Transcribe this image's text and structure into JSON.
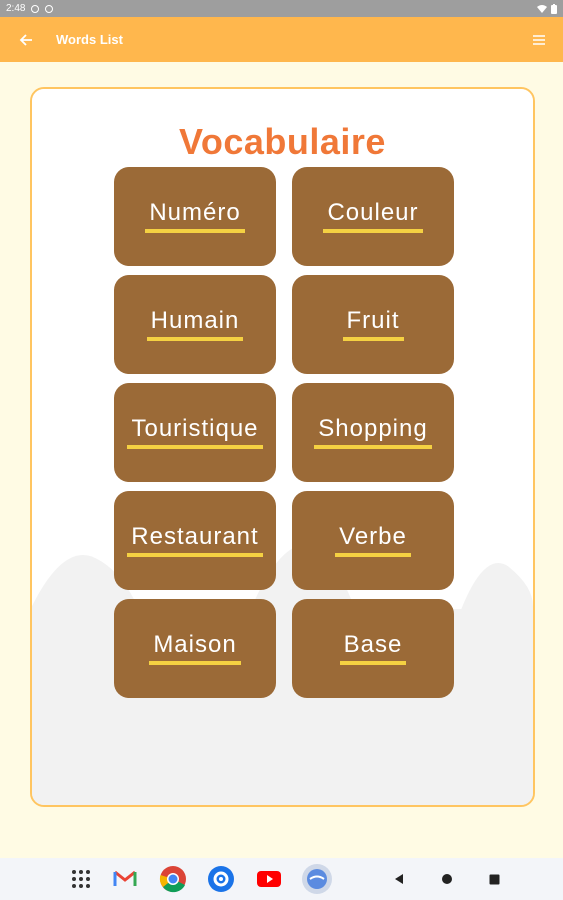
{
  "status_bar": {
    "time": "2:48"
  },
  "app_bar": {
    "title": "Words List"
  },
  "main": {
    "heading": "Vocabulaire",
    "categories": [
      "Numéro",
      "Couleur",
      "Humain",
      "Fruit",
      "Touristique",
      "Shopping",
      "Restaurant",
      "Verbe",
      "Maison",
      "Base"
    ]
  },
  "colors": {
    "app_bar": "#ffb74d",
    "tile": "#9b6a37",
    "underline": "#f5d142",
    "heading": "#f07838",
    "card_border": "#ffc560"
  },
  "nav_icons": [
    "apps-grid-icon",
    "gmail-icon",
    "chrome-icon",
    "settings-icon",
    "youtube-icon",
    "app-icon",
    "back-icon",
    "home-icon",
    "recents-icon"
  ]
}
